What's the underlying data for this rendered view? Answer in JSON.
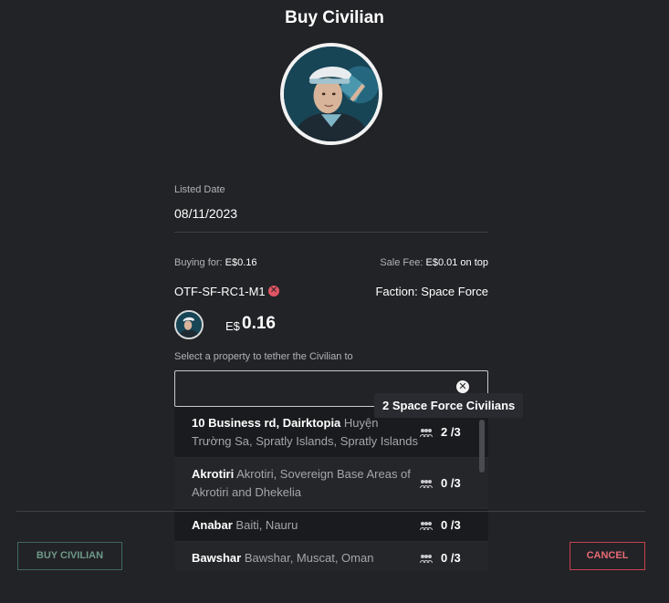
{
  "dialog": {
    "title": "Buy Civilian"
  },
  "listing": {
    "listed_date_label": "Listed Date",
    "listed_date": "08/11/2023",
    "buying_for_label": "Buying for:",
    "buying_for_value": "E$0.16",
    "sale_fee_label": "Sale Fee:",
    "sale_fee_value": "E$0.01 on top",
    "item_code": "OTF-SF-RC1-M1",
    "faction": "Faction: Space Force",
    "price_currency": "E$",
    "price_value": "0.16"
  },
  "property_select": {
    "label": "Select a property to tether the Civilian to",
    "value": "",
    "tooltip": "2 Space Force Civilians",
    "options": [
      {
        "name": "10 Business rd, Dairktopia",
        "detail": "Huyện Trường Sa, Spratly Islands, Spratly Islands",
        "count": "2 /3"
      },
      {
        "name": "Akrotiri",
        "detail": "Akrotiri, Sovereign Base Areas of Akrotiri and Dhekelia",
        "count": "0 /3"
      },
      {
        "name": "Anabar",
        "detail": "Baiti, Nauru",
        "count": "0 /3"
      },
      {
        "name": "Bawshar",
        "detail": "Bawshar, Muscat, Oman",
        "count": "0 /3"
      }
    ]
  },
  "footer": {
    "buy_label": "BUY CIVILIAN",
    "cancel_label": "CANCEL"
  },
  "colors": {
    "background": "#222327",
    "cancel_accent": "#c6434d",
    "buy_accent": "#3e6a5a",
    "remove_icon": "#e25563"
  },
  "icons": {
    "remove": "close-circle-icon",
    "clear": "clear-circle-icon",
    "civilians": "civilians-group-icon"
  }
}
